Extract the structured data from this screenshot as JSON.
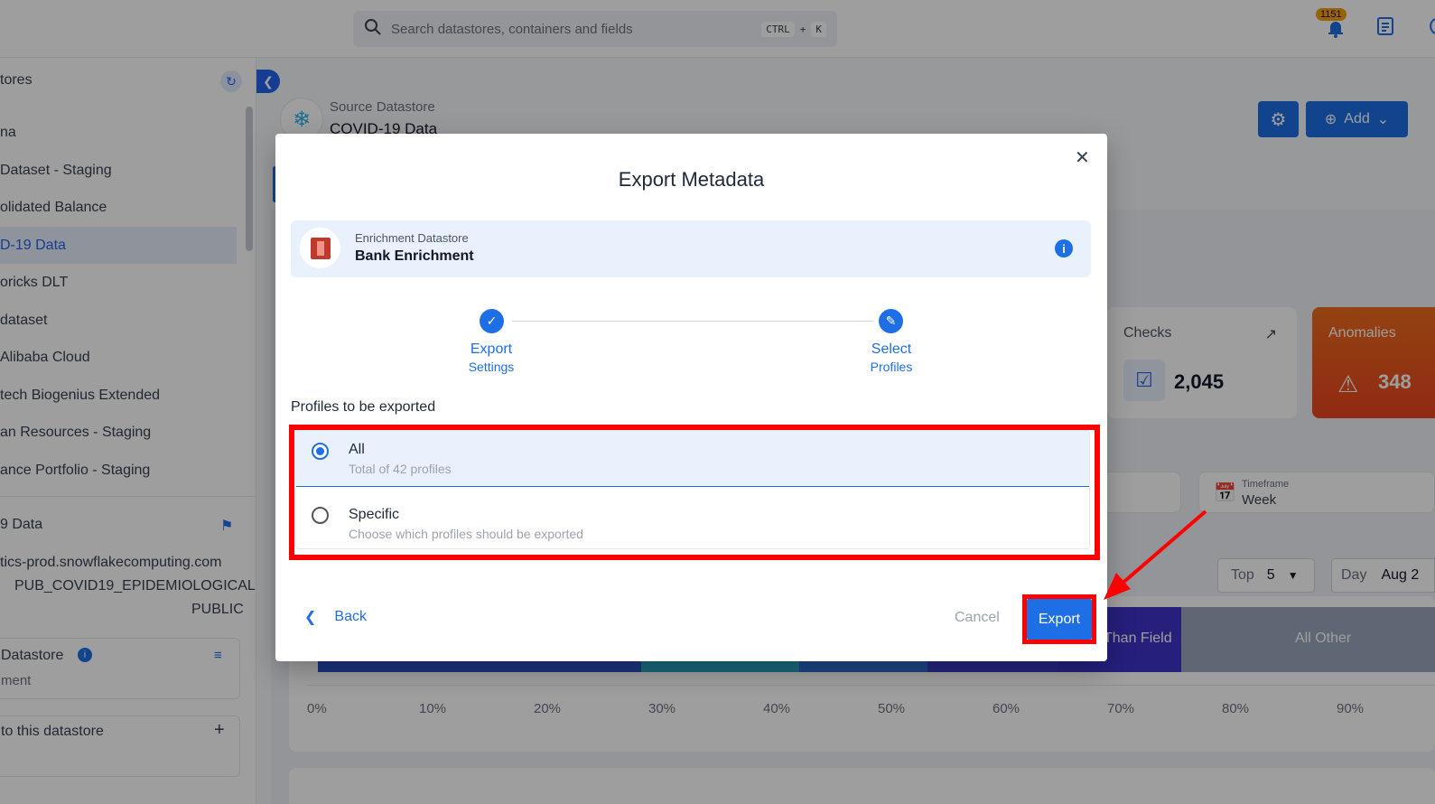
{
  "topbar": {
    "search_placeholder": "Search datastores, containers and fields",
    "shortcut_ctrl": "CTRL",
    "shortcut_plus": "+",
    "shortcut_key": "K",
    "notification_count": "1151"
  },
  "sidebar": {
    "heading": "tores",
    "items": [
      {
        "label": "na"
      },
      {
        "label": "Dataset - Staging"
      },
      {
        "label": "olidated Balance"
      },
      {
        "label": "D-19 Data"
      },
      {
        "label": "oricks DLT"
      },
      {
        "label": "dataset"
      },
      {
        "label": "Alibaba Cloud"
      },
      {
        "label": "tech Biogenius Extended"
      },
      {
        "label": "an Resources - Staging"
      },
      {
        "label": "ance Portfolio - Staging"
      }
    ],
    "detail_title": "9 Data",
    "detail_host": "tics-prod.snowflakecomputing.com",
    "detail_db": "PUB_COVID19_EPIDEMIOLOGICAL",
    "detail_schema": "PUBLIC",
    "enrichment_label": "Datastore",
    "enrichment_value": "ment",
    "link_label": "to this datastore"
  },
  "main": {
    "source_label": "Source Datastore",
    "source_name": "COVID-19 Data",
    "add_label": "Add",
    "checks_label": "Checks",
    "checks_value": "2,045",
    "anomalies_label": "Anomalies",
    "anomalies_value": "348",
    "timeframe_label": "Timeframe",
    "timeframe_value": "Week",
    "top_label": "Top",
    "top_value": "5",
    "day_label": "Day",
    "day_value": "Aug 2",
    "bar_label_1": "Than Field",
    "bar_label_2": "All Other",
    "axis": [
      "0%",
      "10%",
      "20%",
      "30%",
      "40%",
      "50%",
      "60%",
      "70%",
      "80%",
      "90%"
    ]
  },
  "modal": {
    "title": "Export Metadata",
    "enrichment_label": "Enrichment Datastore",
    "enrichment_name": "Bank Enrichment",
    "step1_line1": "Export",
    "step1_line2": "Settings",
    "step2_line1": "Select",
    "step2_line2": "Profiles",
    "profiles_title": "Profiles to be exported",
    "option_all_title": "All",
    "option_all_sub": "Total of 42 profiles",
    "option_specific_title": "Specific",
    "option_specific_sub": "Choose which profiles should be exported",
    "back_label": "Back",
    "cancel_label": "Cancel",
    "export_label": "Export"
  },
  "colors": {
    "accent": "#1e6ee6",
    "highlight": "#ff0000",
    "anomalies": "#ef6c1c"
  }
}
